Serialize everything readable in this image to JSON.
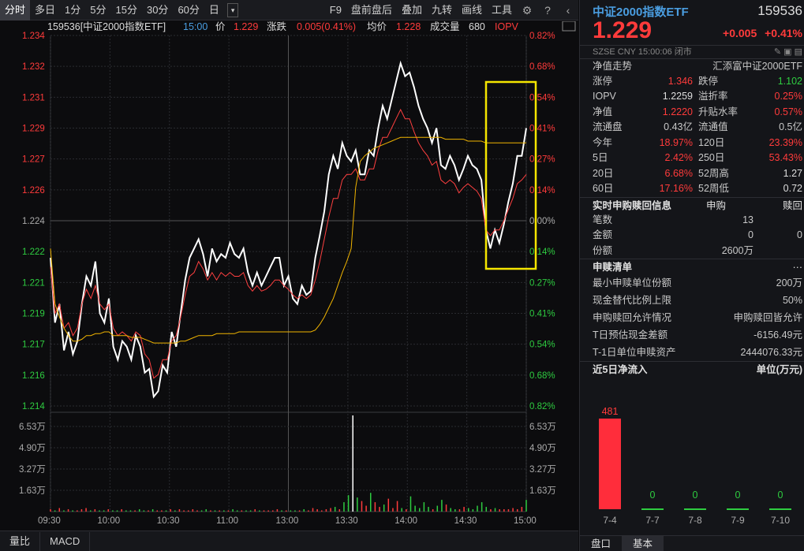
{
  "toolbar": {
    "tabs": [
      "分时",
      "多日",
      "1分",
      "5分",
      "15分",
      "30分",
      "60分",
      "日"
    ],
    "dropdown": "▾",
    "tools": [
      "F9",
      "盘前盘后",
      "叠加",
      "九转",
      "画线",
      "工具"
    ]
  },
  "quote_line": {
    "code_name": "159536[中证2000指数ETF]",
    "time": "15:00",
    "price_label": "价",
    "price": "1.229",
    "change_label": "涨跌",
    "change": "0.005(0.41%)",
    "avg_label": "均价",
    "avg": "1.228",
    "volume_label": "成交量",
    "volume": "680",
    "iopv_label": "IOPV"
  },
  "chart_data": {
    "type": "line",
    "y_ticks": [
      "1.234",
      "1.232",
      "1.231",
      "1.229",
      "1.227",
      "1.226",
      "1.224",
      "1.222",
      "1.221",
      "1.219",
      "1.217",
      "1.216",
      "1.214"
    ],
    "pct_ticks": [
      "0.82%",
      "0.68%",
      "0.54%",
      "0.41%",
      "0.27%",
      "0.14%",
      "0.00%",
      "0.14%",
      "0.27%",
      "0.41%",
      "0.54%",
      "0.68%",
      "0.82%"
    ],
    "vol_ticks": [
      "6.53万",
      "4.90万",
      "3.27万",
      "1.63万"
    ],
    "x_ticks": [
      "09:30",
      "10:00",
      "10:30",
      "11:00",
      "13:00",
      "13:30",
      "14:00",
      "14:30",
      "15:00"
    ],
    "y_range": [
      1.214,
      1.234
    ],
    "prev_close": 1.224,
    "series": [
      {
        "values": [
          1.222,
          1.2185,
          1.2195,
          1.217,
          1.218,
          1.2168,
          1.2175,
          1.2195,
          1.221,
          1.2205,
          1.2218,
          1.219,
          1.2185,
          1.2198,
          1.2172,
          1.2165,
          1.2175,
          1.2172,
          1.2165,
          1.2178,
          1.2172,
          1.2158,
          1.216,
          1.2145,
          1.2148,
          1.2162,
          1.2158,
          1.218,
          1.2172,
          1.219,
          1.2208,
          1.222,
          1.2225,
          1.223,
          1.2222,
          1.221,
          1.2225,
          1.2218,
          1.2222,
          1.222,
          1.2228,
          1.2222,
          1.222,
          1.2225,
          1.2212,
          1.2205,
          1.2212,
          1.2205,
          1.221,
          1.2215,
          1.222,
          1.222,
          1.2205,
          1.221,
          1.2198,
          1.2195,
          1.2205,
          1.22,
          1.2202,
          1.222,
          1.2232,
          1.2245,
          1.2265,
          1.2275,
          1.2268,
          1.2282,
          1.2275,
          1.2272,
          1.2278,
          1.2265,
          1.2265,
          1.2278,
          1.2275,
          1.229,
          1.2302,
          1.2295,
          1.2305,
          1.2315,
          1.2325,
          1.2318,
          1.232,
          1.2312,
          1.2302,
          1.2295,
          1.229,
          1.2282,
          1.229,
          1.227,
          1.2268,
          1.2275,
          1.227,
          1.2262,
          1.2268,
          1.2275,
          1.227,
          1.2268,
          1.2262,
          1.2235,
          1.2225,
          1.2235,
          1.2228,
          1.2238,
          1.225,
          1.226,
          1.2275,
          1.2275,
          1.229
        ]
      },
      {
        "values": [
          1.2215,
          1.219,
          1.2195,
          1.2182,
          1.2185,
          1.2178,
          1.2182,
          1.2195,
          1.2203,
          1.2198,
          1.2205,
          1.2195,
          1.2192,
          1.2195,
          1.2182,
          1.2178,
          1.218,
          1.2178,
          1.2175,
          1.218,
          1.2178,
          1.2168,
          1.2165,
          1.2155,
          1.2157,
          1.2165,
          1.2165,
          1.2175,
          1.2178,
          1.2188,
          1.22,
          1.221,
          1.2212,
          1.2218,
          1.2214,
          1.2208,
          1.2212,
          1.2208,
          1.2212,
          1.221,
          1.2212,
          1.221,
          1.221,
          1.2212,
          1.2205,
          1.2202,
          1.2205,
          1.2202,
          1.2203,
          1.2205,
          1.2208,
          1.2208,
          1.2205,
          1.2203,
          1.22,
          1.2198,
          1.22,
          1.2198,
          1.22,
          1.2208,
          1.2218,
          1.223,
          1.2242,
          1.2252,
          1.2252,
          1.2262,
          1.2265,
          1.2265,
          1.2268,
          1.2262,
          1.2262,
          1.2268,
          1.2268,
          1.2278,
          1.2285,
          1.2285,
          1.229,
          1.2295,
          1.23,
          1.2295,
          1.2295,
          1.2288,
          1.2282,
          1.2278,
          1.2275,
          1.227,
          1.2272,
          1.2262,
          1.226,
          1.2262,
          1.226,
          1.2255,
          1.2258,
          1.226,
          1.2258,
          1.2256,
          1.2252,
          1.2235,
          1.2232,
          1.2235,
          1.2235,
          1.224,
          1.2246,
          1.2252,
          1.226,
          1.2262,
          1.2265
        ]
      },
      {
        "values": [
          1.2225,
          1.2195,
          1.2188,
          1.2182,
          1.2178,
          1.2175,
          1.2175,
          1.2176,
          1.2178,
          1.2178,
          1.2179,
          1.2179,
          1.218,
          1.218,
          1.2178,
          1.2178,
          1.2178,
          1.2178,
          1.2177,
          1.2177,
          1.2177,
          1.2176,
          1.2175,
          1.2174,
          1.2174,
          1.2174,
          1.2174,
          1.2174,
          1.2174,
          1.2175,
          1.2175,
          1.2176,
          1.2177,
          1.2178,
          1.2178,
          1.2178,
          1.2178,
          1.2179,
          1.2179,
          1.2179,
          1.2179,
          1.2179,
          1.218,
          1.218,
          1.218,
          1.218,
          1.218,
          1.218,
          1.218,
          1.218,
          1.218,
          1.218,
          1.218,
          1.218,
          1.218,
          1.218,
          1.218,
          1.218,
          1.218,
          1.2181,
          1.2184,
          1.2188,
          1.2193,
          1.2198,
          1.2205,
          1.2212,
          1.2218,
          1.2225,
          1.2258,
          1.2272,
          1.2275,
          1.2277,
          1.2279,
          1.228,
          1.2281,
          1.2282,
          1.2283,
          1.2284,
          1.2285,
          1.2285,
          1.2285,
          1.2285,
          1.2285,
          1.2285,
          1.2285,
          1.2285,
          1.2285,
          1.2285,
          1.2284,
          1.2284,
          1.2284,
          1.2284,
          1.2284,
          1.2283,
          1.2283,
          1.2283,
          1.2283,
          1.2282,
          1.2282,
          1.2282,
          1.2282,
          1.2282,
          1.2282,
          1.2282,
          1.2282,
          1.2282,
          1.2282
        ]
      }
    ],
    "volume_values": [
      0.2,
      0.1,
      0.3,
      0.1,
      0.2,
      0.1,
      0.1,
      0.2,
      0.3,
      0.1,
      0.2,
      0.1,
      0.1,
      0.2,
      0.1,
      0.1,
      0.2,
      0.1,
      0.1,
      0.1,
      0.2,
      0.1,
      0.1,
      0.2,
      0.1,
      0.1,
      0.1,
      0.2,
      0.1,
      0.2,
      0.1,
      0.1,
      0.2,
      0.1,
      0.1,
      0.2,
      0.1,
      0.1,
      0.1,
      0.1,
      0.1,
      0.2,
      0.1,
      0.1,
      0.1,
      0.1,
      0.2,
      0.1,
      0.1,
      0.1,
      0.1,
      0.2,
      0.1,
      0.1,
      0.1,
      0.1,
      0.1,
      0.2,
      0.1,
      0.3,
      0.2,
      0.1,
      0.2,
      0.3,
      0.4,
      0.2,
      0.8,
      1.4,
      8.3,
      1.2,
      0.9,
      0.5,
      1.6,
      0.8,
      0.4,
      0.6,
      1.1,
      0.3,
      0.9,
      0.3,
      0.2,
      1.3,
      0.5,
      0.3,
      0.8,
      0.4,
      0.2,
      0.5,
      1.0,
      0.6,
      0.3,
      0.2,
      0.2,
      0.4,
      0.3,
      0.2,
      0.5,
      0.8,
      0.4,
      0.2,
      0.3,
      0.2,
      0.2,
      0.2,
      0.3,
      0.2,
      0.4,
      1.0
    ],
    "volume_max": 8.2
  },
  "right": {
    "name": "中证2000指数ETF",
    "code": "159536",
    "price": "1.229",
    "change": "+0.005",
    "change_pct": "+0.41%",
    "meta_left": "SZSE  CNY  15:00:06  闭市",
    "nav_trend": "净值走势",
    "fund_company": "汇添富中证2000ETF",
    "rows": [
      [
        "涨停",
        "1.346",
        "跌停",
        "1.102"
      ],
      [
        "IOPV",
        "1.2259",
        "溢折率",
        "0.25%"
      ],
      [
        "净值",
        "1.2220",
        "升贴水率",
        "0.57%"
      ],
      [
        "流通盘",
        "0.43亿",
        "流通值",
        "0.5亿"
      ],
      [
        "今年",
        "18.97%",
        "120日",
        "23.39%"
      ],
      [
        "5日",
        "2.42%",
        "250日",
        "53.43%"
      ],
      [
        "20日",
        "6.68%",
        "52周高",
        "1.27"
      ],
      [
        "60日",
        "17.16%",
        "52周低",
        "0.72"
      ]
    ],
    "realtime": {
      "title": "实时申购赎回信息",
      "c2": "申购",
      "c3": "赎回",
      "rows": [
        [
          "笔数",
          "13",
          ""
        ],
        [
          "金额",
          "0",
          "0"
        ],
        [
          "份额",
          "2600万",
          ""
        ]
      ]
    },
    "redeem": {
      "title": "申赎清单",
      "more": "···",
      "rows": [
        [
          "最小申赎单位份额",
          "200万"
        ],
        [
          "现金替代比例上限",
          "50%"
        ],
        [
          "申购赎回允许情况",
          "申购赎回皆允许"
        ],
        [
          "T日预估现金差额",
          "-6156.49元"
        ],
        [
          "T-1日单位申赎资产",
          "2444076.33元"
        ]
      ]
    },
    "flow": {
      "title": "近5日净流入",
      "unit": "单位(万元)",
      "bars": [
        {
          "date": "7-4",
          "value": 481
        },
        {
          "date": "7-7",
          "value": 0
        },
        {
          "date": "7-8",
          "value": 0
        },
        {
          "date": "7-9",
          "value": 0
        },
        {
          "date": "7-10",
          "value": 0
        }
      ]
    },
    "bottom_tabs": [
      "盘口",
      "基本"
    ]
  },
  "bottom": {
    "tabs": [
      "量比",
      "MACD"
    ]
  }
}
